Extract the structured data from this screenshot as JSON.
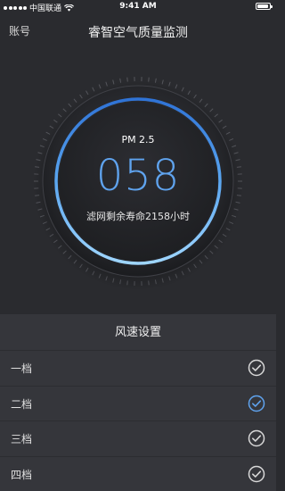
{
  "status_bar": {
    "carrier": "中国联通",
    "time": "9:41 AM"
  },
  "nav": {
    "account_label": "账号",
    "title": "睿智空气质量监测"
  },
  "gauge": {
    "label": "PM 2.5",
    "value": "058",
    "subtitle": "滤网剩余寿命2158小时",
    "accent_color": "#5fa3ee"
  },
  "fan_speed": {
    "title": "风速设置",
    "items": [
      {
        "label": "一档",
        "selected": false
      },
      {
        "label": "二档",
        "selected": true
      },
      {
        "label": "三档",
        "selected": false
      },
      {
        "label": "四档",
        "selected": false
      }
    ]
  },
  "colors": {
    "background": "#2a2b2f",
    "panel": "#35363b",
    "selected_check": "#5fa3ee",
    "unselected_check": "#d8d8d8"
  }
}
